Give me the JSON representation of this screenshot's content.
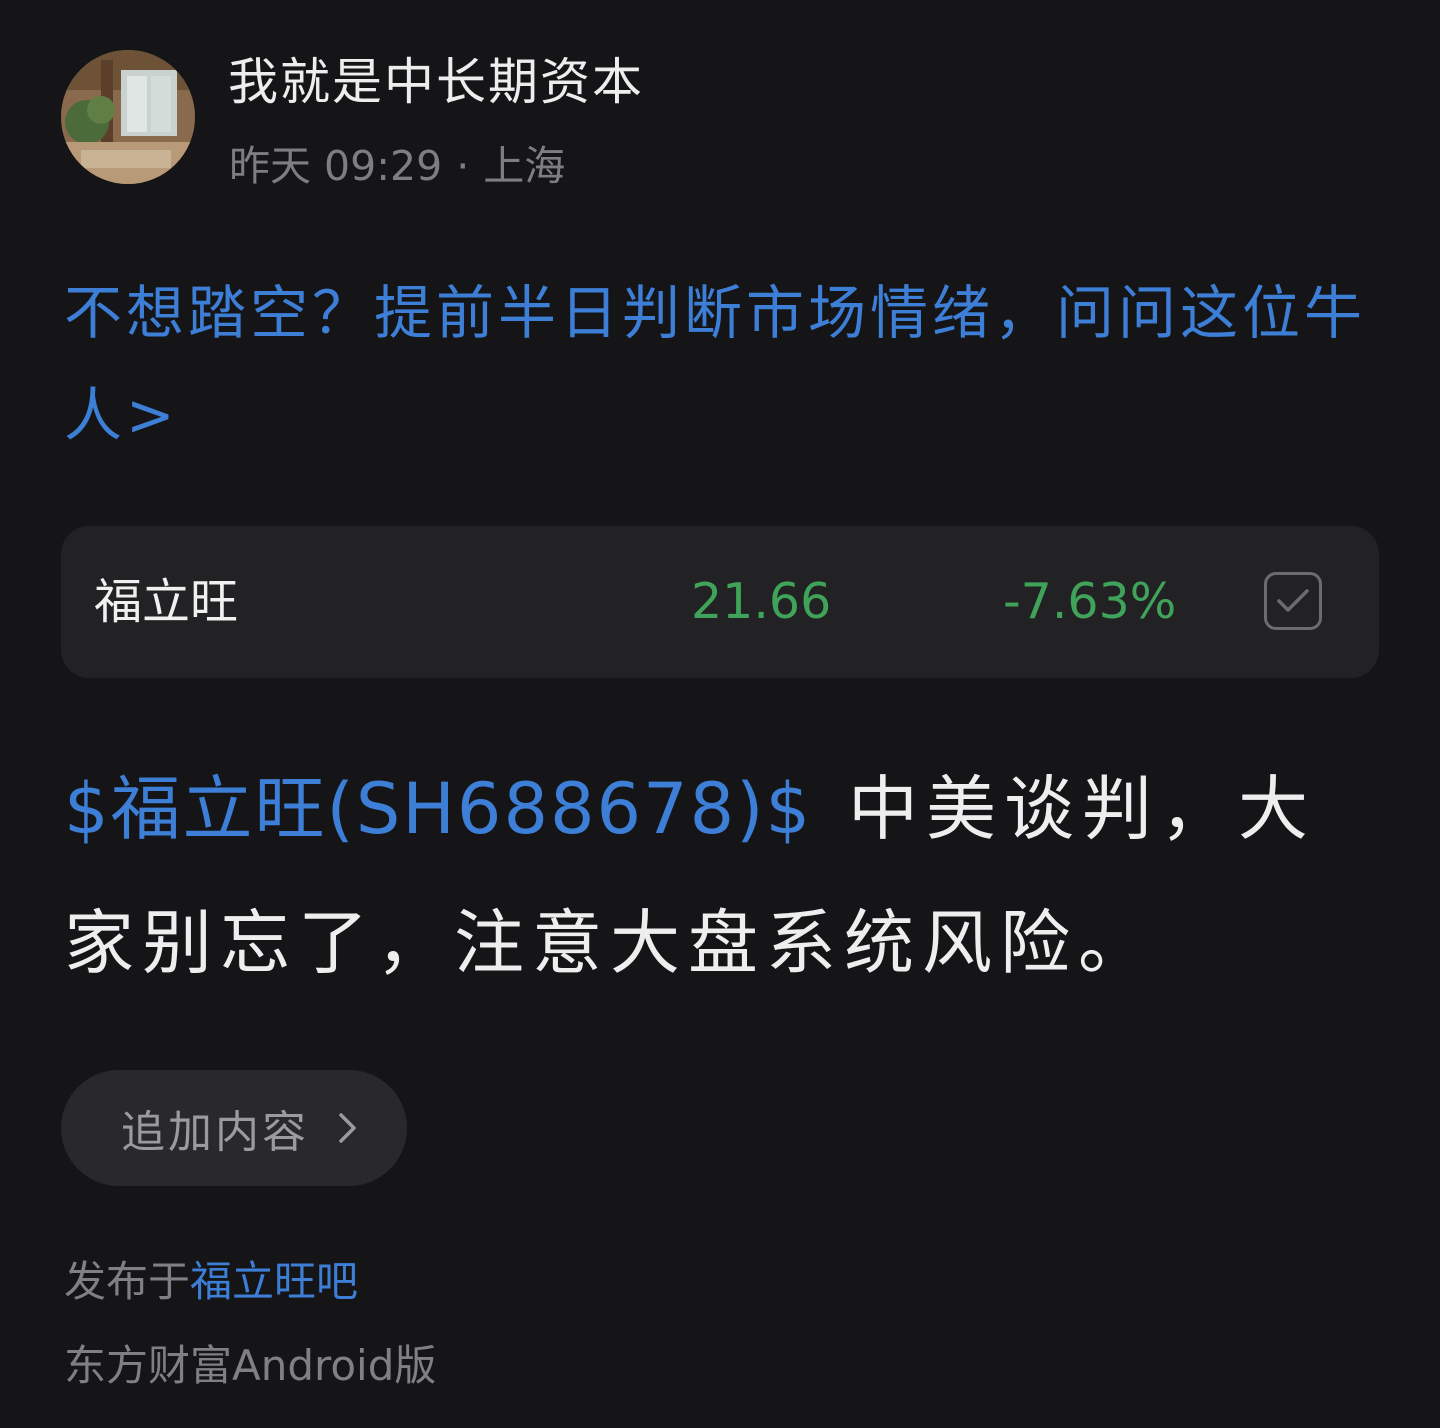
{
  "post": {
    "author": {
      "name": "我就是中长期资本"
    },
    "meta": {
      "time": "昨天 09:29",
      "separator": "·",
      "location": "上海"
    },
    "promo_link": "不想踏空？提前半日判断市场情绪，问问这位牛人>",
    "stock_card": {
      "name": "福立旺",
      "price": "21.66",
      "change": "-7.63%",
      "price_color": "#3fa35a",
      "watch_icon": "checkbox-checked-icon"
    },
    "body": {
      "stock_tag": "$福立旺(SH688678)$",
      "text": "中美谈判，大家别忘了，注意大盘系统风险。"
    },
    "add_content_label": "追加内容",
    "published_in_prefix": "发布于",
    "forum_name": "福立旺吧",
    "client_source": "东方财富Android版"
  },
  "colors": {
    "background": "#151517",
    "card": "#222225",
    "link_blue": "#3d7ed6",
    "down_green": "#3fa35a",
    "muted_text": "#7f7f84"
  }
}
